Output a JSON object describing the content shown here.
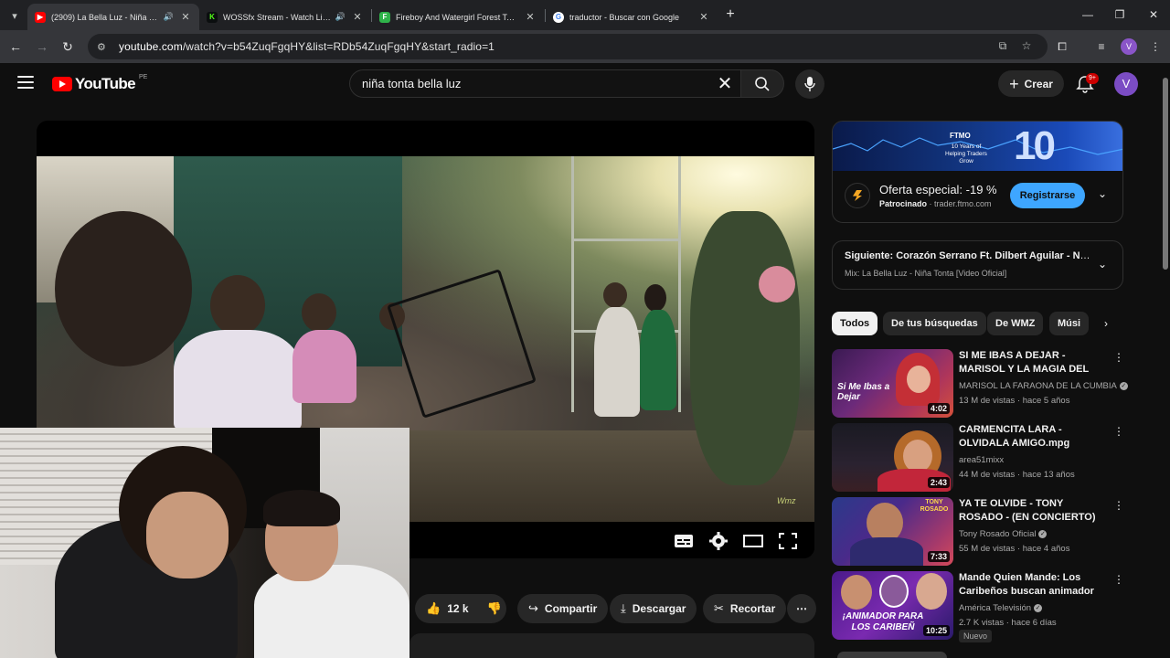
{
  "browser": {
    "tabs": [
      {
        "title": "(2909) La Bella Luz - Niña Tonta [",
        "favicon_color": "#ff0000",
        "audio": true,
        "active": true
      },
      {
        "title": "WOSSfx Stream - Watch Live on",
        "favicon_color": "#53fc18",
        "audio": true,
        "active": false
      },
      {
        "title": "Fireboy And Watergirl Forest Temple",
        "favicon_color": "#2fb34a",
        "audio": false,
        "active": false
      },
      {
        "title": "traductor - Buscar con Google",
        "favicon_color": "#4285f4",
        "audio": false,
        "active": false
      }
    ],
    "url_host": "youtube.com",
    "url_path": "/watch?v=b54ZuqFgqHY&list=RDb54ZuqFgqHY&start_radio=1",
    "profile_initial": "V"
  },
  "youtube": {
    "logo_text": "YouTube",
    "region": "PE",
    "search_value": "niña tonta bella luz",
    "create_label": "Crear",
    "notif_count": "9+",
    "avatar_initial": "V"
  },
  "player": {
    "watermark": "Wmz"
  },
  "actions": {
    "likes": "12 k",
    "share": "Compartir",
    "download": "Descargar",
    "clip": "Recortar"
  },
  "ad": {
    "brand": "FTMO",
    "banner_tagline": "10 Years of Helping Traders Grow",
    "banner_number": "10",
    "title": "Oferta especial: -19 %",
    "sponsored": "Patrocinado",
    "domain": "trader.ftmo.com",
    "cta": "Registrarse"
  },
  "up_next": {
    "prefix": "Siguiente:",
    "title": "Corazón Serrano Ft. Dilbert Aguilar - No T...",
    "mix": "Mix: La Bella Luz - Niña Tonta [Video Oficial]"
  },
  "chips": [
    "Todos",
    "De tus búsquedas",
    "De WMZ",
    "Músi"
  ],
  "recommendations": [
    {
      "title": "SI ME IBAS A DEJAR - MARISOL Y LA MAGIA DEL NORTE / ...",
      "channel": "MARISOL LA FARAONA DE LA CUMBIA",
      "verified": true,
      "meta": "13 M de vistas · hace 5 años",
      "duration": "4:02",
      "thumb_text": "Si Me Ibas a Dejar",
      "badge": ""
    },
    {
      "title": "CARMENCITA LARA - OLVIDALA AMIGO.mpg",
      "channel": "area51mixx",
      "verified": false,
      "meta": "44 M de vistas · hace 13 años",
      "duration": "2:43",
      "thumb_text": "",
      "badge": ""
    },
    {
      "title": "YA TE OLVIDE - TONY ROSADO - (EN CONCIERTO)",
      "channel": "Tony Rosado Oficial",
      "verified": true,
      "meta": "55 M de vistas · hace 4 años",
      "duration": "7:33",
      "thumb_text": "TONY ROSADO",
      "badge": ""
    },
    {
      "title": "Mande Quien Mande: Los Caribeños buscan animador ...",
      "channel": "América Televisión",
      "verified": true,
      "meta": "2.7 K vistas · hace 6 días",
      "duration": "10:25",
      "thumb_text": "¡ANIMADOR PARA LOS CARIBEÑ",
      "badge": "Nuevo"
    }
  ]
}
